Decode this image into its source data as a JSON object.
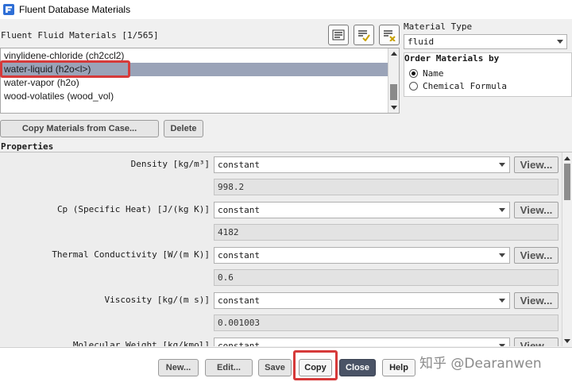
{
  "window": {
    "title": "Fluent Database Materials"
  },
  "materials": {
    "list_title": "Fluent Fluid Materials [1/565]",
    "items": [
      {
        "label": "vinylidene-chloride (ch2ccl2)",
        "selected": false
      },
      {
        "label": "water-liquid (h2o<l>)",
        "selected": true
      },
      {
        "label": "water-vapor (h2o)",
        "selected": false
      },
      {
        "label": "wood-volatiles (wood_vol)",
        "selected": false
      }
    ],
    "toolbar_icons": [
      "list-icon",
      "list-check-icon",
      "list-clear-icon"
    ]
  },
  "material_type": {
    "label": "Material Type",
    "value": "fluid"
  },
  "order_by": {
    "label": "Order Materials by",
    "options": [
      {
        "label": "Name",
        "selected": true
      },
      {
        "label": "Chemical Formula",
        "selected": false
      }
    ]
  },
  "actions": {
    "copy_from_case": "Copy Materials from Case...",
    "delete": "Delete"
  },
  "properties": {
    "title": "Properties",
    "items": [
      {
        "label": "Density [kg/m³]",
        "method": "constant",
        "view": "View...",
        "value": "998.2"
      },
      {
        "label": "Cp (Specific Heat) [J/(kg K)]",
        "method": "constant",
        "view": "View...",
        "value": "4182"
      },
      {
        "label": "Thermal Conductivity [W/(m K)]",
        "method": "constant",
        "view": "View...",
        "value": "0.6"
      },
      {
        "label": "Viscosity [kg/(m s)]",
        "method": "constant",
        "view": "View...",
        "value": "0.001003"
      },
      {
        "label": "Molecular Weight [kg/kmol]",
        "method": "constant",
        "view": "View..."
      }
    ]
  },
  "footer": {
    "new": "New...",
    "edit": "Edit...",
    "save": "Save",
    "copy": "Copy",
    "close": "Close",
    "help": "Help"
  },
  "watermark": "知乎 @Dearanwen",
  "colors": {
    "selection": "#9aa3b8",
    "highlight_box": "#d63a3a",
    "primary_button": "#4a5366"
  }
}
